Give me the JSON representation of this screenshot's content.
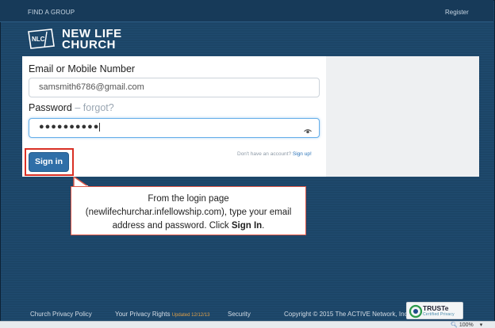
{
  "header": {
    "find_group": "FIND A GROUP",
    "register": "Register"
  },
  "logo": {
    "badge_text": "NLC",
    "name_line1": "NEW LIFE",
    "name_line2": "CHURCH"
  },
  "login_form": {
    "email_label": "Email or Mobile Number",
    "email_value": "samsmith6786@gmail.com",
    "password_label": "Password",
    "forgot_text": " – forgot?",
    "password_mask": "●●●●●●●●●●",
    "signup_prompt": "Don't have an account? ",
    "signup_link": "Sign up!",
    "signin_label": "Sign in"
  },
  "callout": {
    "line1": "From the login page",
    "line2": "(newlifechurchar.infellowship.com), type your email",
    "line3_prefix": "address and password.  Click ",
    "line3_bold": "Sign In",
    "line3_suffix": "."
  },
  "footer": {
    "privacy_policy": "Church Privacy Policy",
    "privacy_rights": "Your Privacy Rights",
    "updated_note": "Updated 12/12/13",
    "security": "Security",
    "copyright": "Copyright © 2015 The ACTIVE Network, Inc",
    "truste_name": "TRUSTe",
    "truste_sub": "Certified Privacy"
  },
  "status_bar": {
    "zoom": "100%"
  },
  "colors": {
    "page_background": "#1d4668",
    "primary_button": "#2f6fa8",
    "highlight": "#d93025",
    "link": "#2a73b8"
  }
}
